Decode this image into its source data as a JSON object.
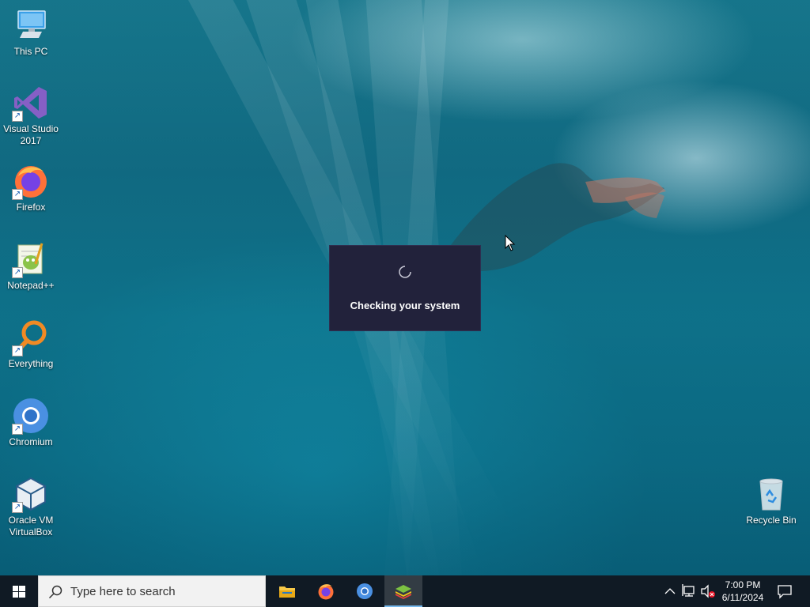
{
  "desktop": {
    "icons": [
      {
        "label_line1": "This PC",
        "label_line2": "",
        "icon": "this-pc-icon"
      },
      {
        "label_line1": "Visual Studio",
        "label_line2": "2017",
        "icon": "visual-studio-icon"
      },
      {
        "label_line1": "Firefox",
        "label_line2": "",
        "icon": "firefox-icon"
      },
      {
        "label_line1": "Notepad++",
        "label_line2": "",
        "icon": "notepadpp-icon"
      },
      {
        "label_line1": "Everything",
        "label_line2": "",
        "icon": "everything-icon"
      },
      {
        "label_line1": "Chromium",
        "label_line2": "",
        "icon": "chromium-icon"
      },
      {
        "label_line1": "Oracle VM",
        "label_line2": "VirtualBox",
        "icon": "virtualbox-icon"
      }
    ],
    "recycle_bin": {
      "label": "Recycle Bin",
      "icon": "recycle-bin-icon"
    }
  },
  "dialog": {
    "message": "Checking your system",
    "background": "#22223b"
  },
  "taskbar": {
    "search_placeholder": "Type here to search",
    "pinned_apps": [
      {
        "name": "File Explorer",
        "icon": "file-explorer-icon",
        "active": false
      },
      {
        "name": "Firefox",
        "icon": "firefox-icon",
        "active": false
      },
      {
        "name": "Chromium",
        "icon": "chromium-icon",
        "active": false
      },
      {
        "name": "BlueStacks",
        "icon": "bluestacks-icon",
        "active": true
      }
    ],
    "tray": {
      "time": "7:00 PM",
      "date": "6/11/2024",
      "icons": [
        "chevron-up-icon",
        "network-icon",
        "volume-muted-icon",
        "notification-icon"
      ]
    },
    "accent_color": "#76b9ed"
  }
}
